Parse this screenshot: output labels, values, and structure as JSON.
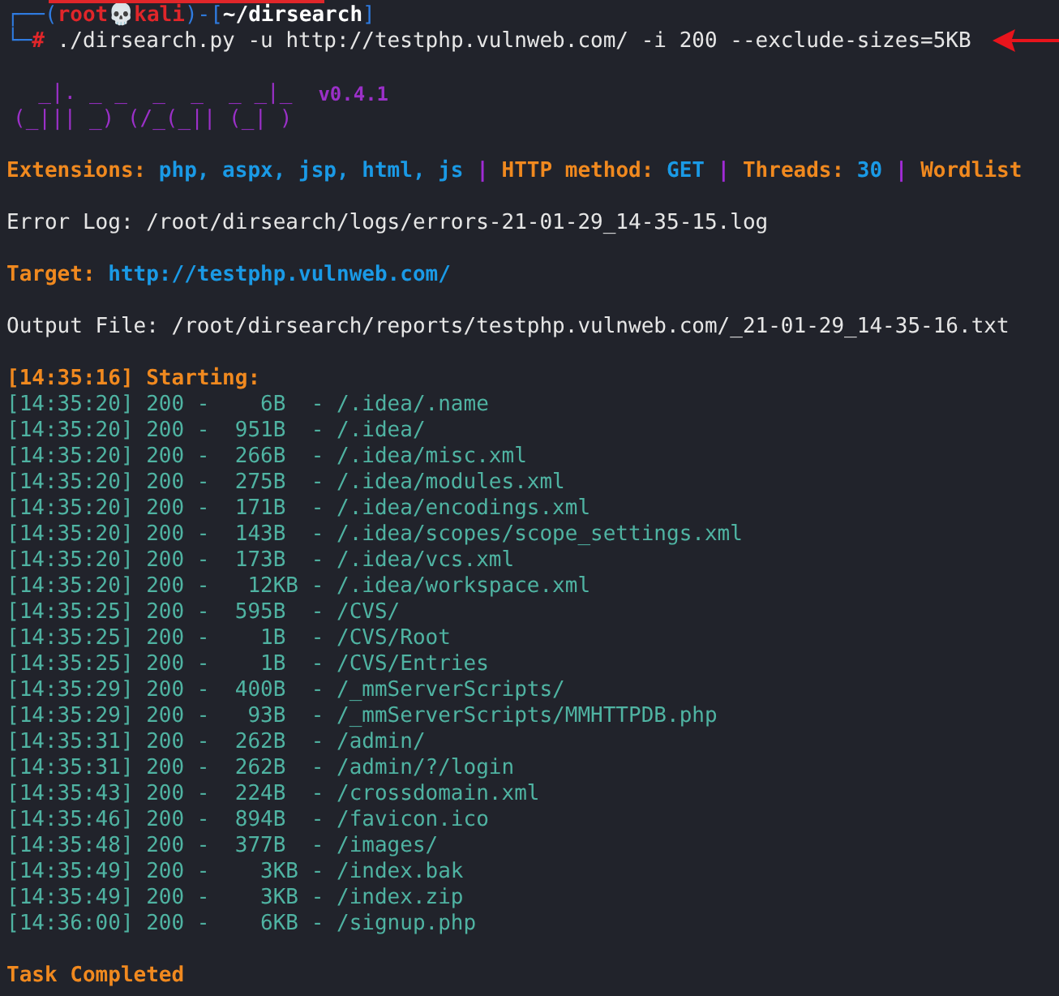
{
  "prompt": {
    "open": "┌──(",
    "user": "root💀kali",
    "mid": ")-[",
    "path": "~/dirsearch",
    "close": "]",
    "corner": "└─",
    "symbol": "#",
    "command": " ./dirsearch.py -u http://testphp.vulnweb.com/ -i 200 --exclude-sizes=5KB"
  },
  "logo": {
    "lines": [
      "  _|. _ _  _  _  _ _|_",
      "(_||| _) (/_(_|| (_| )"
    ],
    "version": "v0.4.1"
  },
  "config": [
    {
      "label": "Extensions:",
      "value": "php, aspx, jsp, html, js"
    },
    {
      "label": "HTTP method:",
      "value": "GET"
    },
    {
      "label": "Threads:",
      "value": "30"
    },
    {
      "label": "Wordlist"
    }
  ],
  "separator": "|",
  "error_log": "Error Log: /root/dirsearch/logs/errors-21-01-29_14-35-15.log",
  "target": {
    "label": "Target:",
    "value": "http://testphp.vulnweb.com/"
  },
  "output_file": "Output File: /root/dirsearch/reports/testphp.vulnweb.com/_21-01-29_14-35-16.txt",
  "start": "[14:35:16] Starting:",
  "results": [
    "[14:35:20] 200 -    6B  - /.idea/.name",
    "[14:35:20] 200 -  951B  - /.idea/",
    "[14:35:20] 200 -  266B  - /.idea/misc.xml",
    "[14:35:20] 200 -  275B  - /.idea/modules.xml",
    "[14:35:20] 200 -  171B  - /.idea/encodings.xml",
    "[14:35:20] 200 -  143B  - /.idea/scopes/scope_settings.xml",
    "[14:35:20] 200 -  173B  - /.idea/vcs.xml",
    "[14:35:20] 200 -   12KB - /.idea/workspace.xml",
    "[14:35:25] 200 -  595B  - /CVS/",
    "[14:35:25] 200 -    1B  - /CVS/Root",
    "[14:35:25] 200 -    1B  - /CVS/Entries",
    "[14:35:29] 200 -  400B  - /_mmServerScripts/",
    "[14:35:29] 200 -   93B  - /_mmServerScripts/MMHTTPDB.php",
    "[14:35:31] 200 -  262B  - /admin/",
    "[14:35:31] 200 -  262B  - /admin/?/login",
    "[14:35:43] 200 -  224B  - /crossdomain.xml",
    "[14:35:46] 200 -  894B  - /favicon.ico",
    "[14:35:48] 200 -  377B  - /images/",
    "[14:35:49] 200 -    3KB - /index.bak",
    "[14:35:49] 200 -    3KB - /index.zip",
    "[14:36:00] 200 -    6KB - /signup.php"
  ],
  "footer": "Task Completed"
}
